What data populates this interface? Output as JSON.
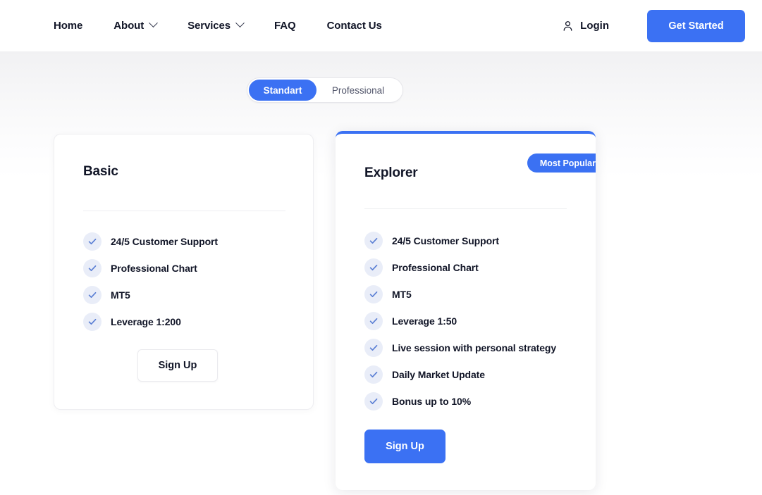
{
  "header": {
    "nav_items": [
      {
        "label": "Home",
        "has_chevron": false
      },
      {
        "label": "About",
        "has_chevron": true
      },
      {
        "label": "Services",
        "has_chevron": true
      },
      {
        "label": "FAQ",
        "has_chevron": false
      },
      {
        "label": "Contact Us",
        "has_chevron": false
      }
    ],
    "login_label": "Login",
    "login_icon": "user-icon",
    "cta_label": "Get Started"
  },
  "toggle": {
    "options": [
      {
        "label": "Standart",
        "active": true
      },
      {
        "label": "Professional",
        "active": false
      }
    ]
  },
  "plans": [
    {
      "id": "basic",
      "title": "Basic",
      "badge": null,
      "features": [
        "24/5 Customer Support",
        "Professional Chart",
        "MT5",
        "Leverage 1:200"
      ],
      "cta_label": "Sign Up"
    },
    {
      "id": "explorer",
      "title": "Explorer",
      "badge": "Most Popular",
      "features": [
        "24/5 Customer Support",
        "Professional Chart",
        "MT5",
        "Leverage 1:50",
        "Live session with personal strategy",
        "Daily Market Update",
        "Bonus up to 10%"
      ],
      "cta_label": "Sign Up"
    }
  ],
  "colors": {
    "accent_blue": "#3b71f3",
    "text_dark": "#111527",
    "check_circle_bg": "#e9edf8",
    "check_mark": "#5b7fd4",
    "page_bg_top": "#f1f1f3"
  }
}
